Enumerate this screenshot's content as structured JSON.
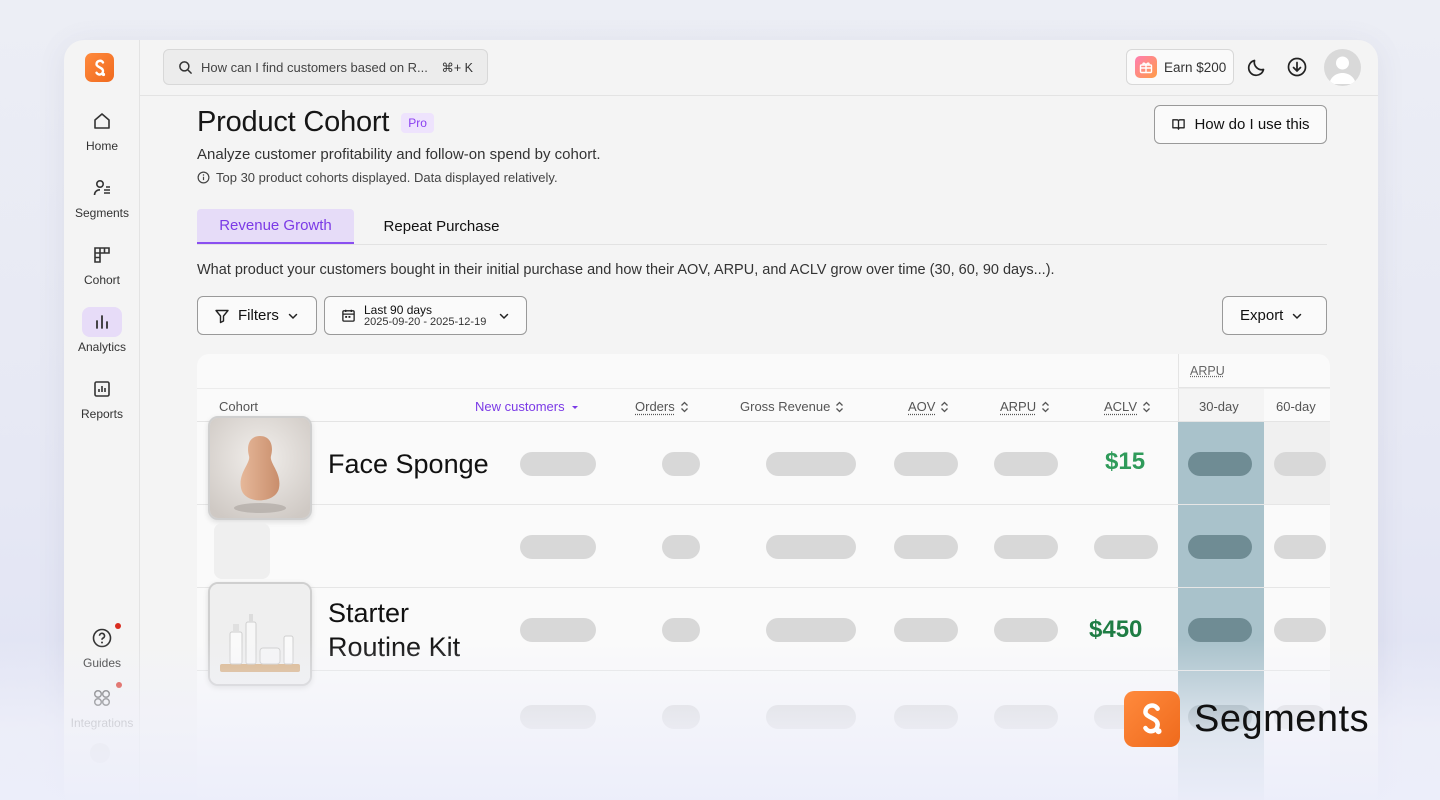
{
  "search": {
    "placeholder": "How can I find customers based on R...",
    "shortcut": "⌘+ K"
  },
  "topbar": {
    "earn_label": "Earn $200"
  },
  "sidebar": {
    "items": [
      {
        "label": "Home",
        "icon": "home-icon"
      },
      {
        "label": "Segments",
        "icon": "segments-icon"
      },
      {
        "label": "Cohort",
        "icon": "cohort-icon"
      },
      {
        "label": "Analytics",
        "icon": "analytics-icon",
        "active": true
      },
      {
        "label": "Reports",
        "icon": "reports-icon"
      }
    ],
    "bottom_items": [
      {
        "label": "Guides",
        "icon": "help-icon"
      },
      {
        "label": "Integrations",
        "icon": "integrations-icon"
      }
    ]
  },
  "page": {
    "title": "Product Cohort",
    "badge": "Pro",
    "subtitle": "Analyze customer profitability and follow-on spend by cohort.",
    "info": "Top 30 product cohorts displayed. Data displayed relatively.",
    "help_button": "How do I use this",
    "tabs": [
      {
        "label": "Revenue Growth",
        "active": true
      },
      {
        "label": "Repeat Purchase",
        "active": false
      }
    ],
    "description": "What product your customers bought in their initial purchase and how their AOV, ARPU, and ACLV grow over time (30, 60, 90 days...).",
    "filters_label": "Filters",
    "date_range": {
      "label": "Last 90 days",
      "range": "2025-09-20 - 2025-12-19"
    },
    "export_label": "Export"
  },
  "table": {
    "group_header": "ARPU",
    "columns": [
      "Cohort",
      "New customers",
      "Orders",
      "Gross Revenue",
      "AOV",
      "ARPU",
      "ACLV",
      "30-day",
      "60-day"
    ],
    "rows": [
      {
        "name": "Face Sponge",
        "aclv": "$15"
      },
      {
        "name": "",
        "aclv": ""
      },
      {
        "name_line1": "Starter",
        "name_line2": "Routine Kit",
        "aclv": "$450"
      }
    ]
  },
  "brand": {
    "name": "Segments"
  },
  "colors": {
    "accent": "#8a4ff0",
    "brand_orange": "#f06a1e",
    "positive": "#2f9b5a",
    "arpu_30_day": "#a9c2cb"
  }
}
